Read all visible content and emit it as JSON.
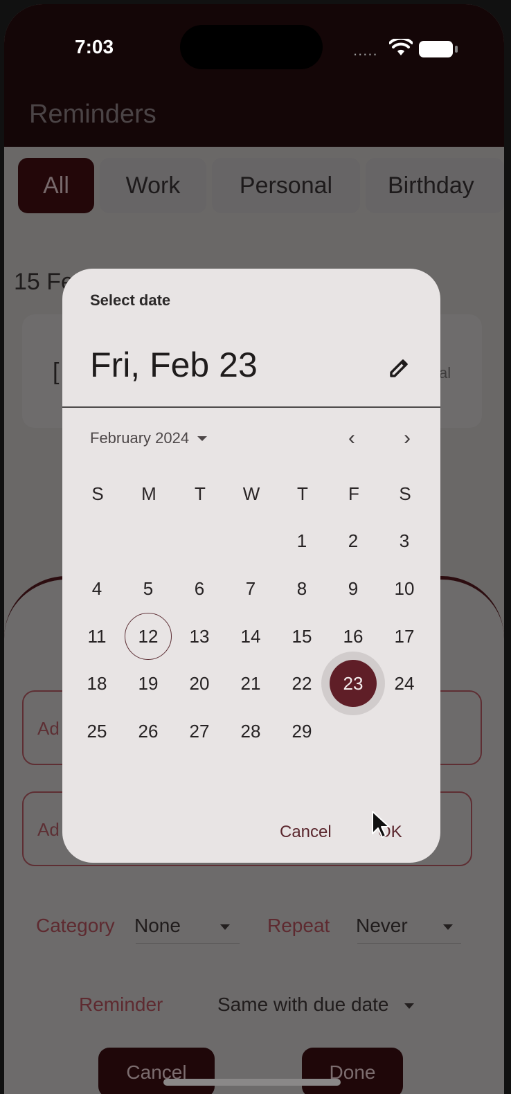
{
  "status_bar": {
    "time": "7:03",
    "signal_dots": "....."
  },
  "app": {
    "title": "Reminders"
  },
  "chips": [
    {
      "label": "All",
      "active": true
    },
    {
      "label": "Work",
      "active": false
    },
    {
      "label": "Personal",
      "active": false
    },
    {
      "label": "Birthday",
      "active": false
    }
  ],
  "background": {
    "date_heading": "15 Fe",
    "card_text": "[",
    "card_right_text": "al"
  },
  "sheet": {
    "title_field_label": "Ad",
    "notes_field_label": "Ad",
    "category_label": "Category",
    "category_value": "None",
    "repeat_label": "Repeat",
    "repeat_value": "Never",
    "reminder_label": "Reminder",
    "reminder_value": "Same with due date",
    "cancel_label": "Cancel",
    "done_label": "Done"
  },
  "date_picker": {
    "help_text": "Select date",
    "selected_headline": "Fri, Feb 23",
    "month_label": "February 2024",
    "weekdays": [
      "S",
      "M",
      "T",
      "W",
      "T",
      "F",
      "S"
    ],
    "days": [
      "1",
      "2",
      "3",
      "4",
      "5",
      "6",
      "7",
      "8",
      "9",
      "10",
      "11",
      "12",
      "13",
      "14",
      "15",
      "16",
      "17",
      "18",
      "19",
      "20",
      "21",
      "22",
      "23",
      "24",
      "25",
      "26",
      "27",
      "28",
      "29"
    ],
    "today": "12",
    "selected_day": "23",
    "cancel_label": "Cancel",
    "ok_label": "OK"
  },
  "colors": {
    "accent": "#5f1e27",
    "dialog_background": "#e8e4e4",
    "scrim": "#6a6867"
  },
  "icons": [
    "wifi-icon",
    "battery-icon",
    "edit-icon",
    "chevron-left-icon",
    "chevron-right-icon",
    "dropdown-arrow-icon",
    "mouse-cursor-icon"
  ]
}
